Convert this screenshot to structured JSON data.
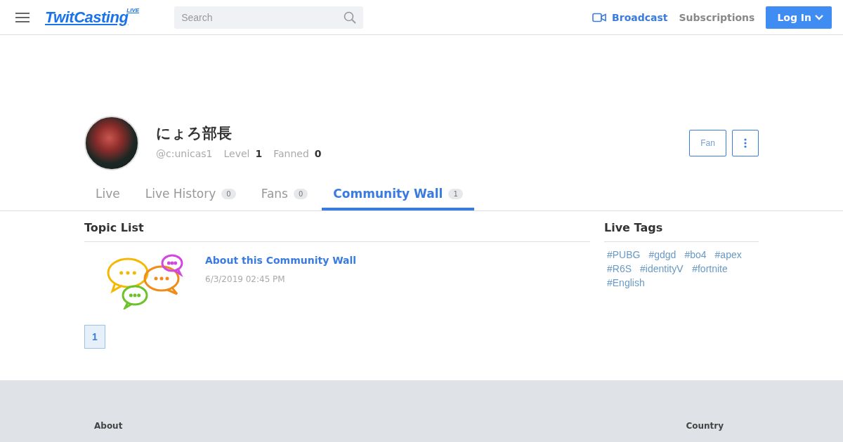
{
  "header": {
    "logo": "TwitCasting",
    "logo_badge": "LIVE",
    "search": {
      "placeholder": "Search"
    },
    "nav": [
      {
        "kind": "broadcast",
        "label": "Broadcast"
      },
      {
        "kind": "plain",
        "label": "Subscriptions"
      }
    ],
    "login": "Log In"
  },
  "profile": {
    "name": "にょろ部長",
    "handle": "@c:unicas1",
    "stats": [
      {
        "label": "Level",
        "value": "1"
      },
      {
        "label": "Fanned",
        "value": "0"
      }
    ],
    "fan_button": "Fan"
  },
  "tabs": [
    {
      "label": "Live",
      "selected": false
    },
    {
      "label": "Live History",
      "count": "0",
      "selected": false
    },
    {
      "label": "Fans",
      "count": "0",
      "selected": false
    },
    {
      "label": "Community Wall",
      "count": "1",
      "selected": true
    }
  ],
  "topics": {
    "title": "Topic List",
    "items": [
      {
        "title": "About this Community Wall",
        "date": "6/3/2019 02:45 PM"
      }
    ],
    "pages": [
      {
        "label": "1",
        "selected": true
      }
    ]
  },
  "live_tags": {
    "title": "Live Tags",
    "tags": [
      "#PUBG",
      "#gdgd",
      "#bo4",
      "#apex",
      "#R6S",
      "#identityⅤ",
      "#fortnite",
      "#English"
    ]
  },
  "footer": {
    "columns": [
      "About",
      "Country"
    ]
  }
}
